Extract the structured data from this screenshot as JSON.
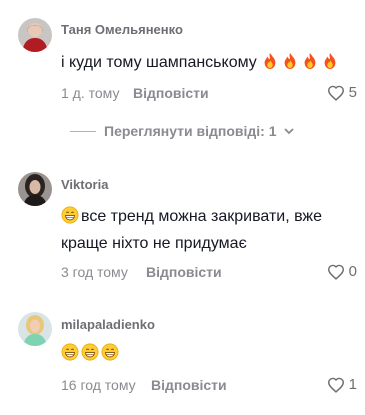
{
  "comments": [
    {
      "username": "Таня Омельяненко",
      "text": "і куди тому шампанському",
      "emojis": [
        "fire",
        "fire",
        "fire",
        "fire"
      ],
      "time": "1 д. тому",
      "reply_label": "Відповісти",
      "likes": "5"
    },
    {
      "username": "Viktoria",
      "text": "все тренд можна закривати, вже краще ніхто не придумає",
      "leading_emoji": "grin",
      "time": "3 год тому",
      "reply_label": "Відповісти",
      "likes": "0"
    },
    {
      "username": "milapaladienko",
      "text": "",
      "emojis": [
        "grin",
        "grin",
        "grin"
      ],
      "time": "16 год тому",
      "reply_label": "Відповісти",
      "likes": "1"
    }
  ],
  "view_replies": {
    "label": "Переглянути відповіді: 1"
  },
  "colors": {
    "text": "#161823",
    "muted": "#8a8b91",
    "username": "#6e6f74"
  }
}
